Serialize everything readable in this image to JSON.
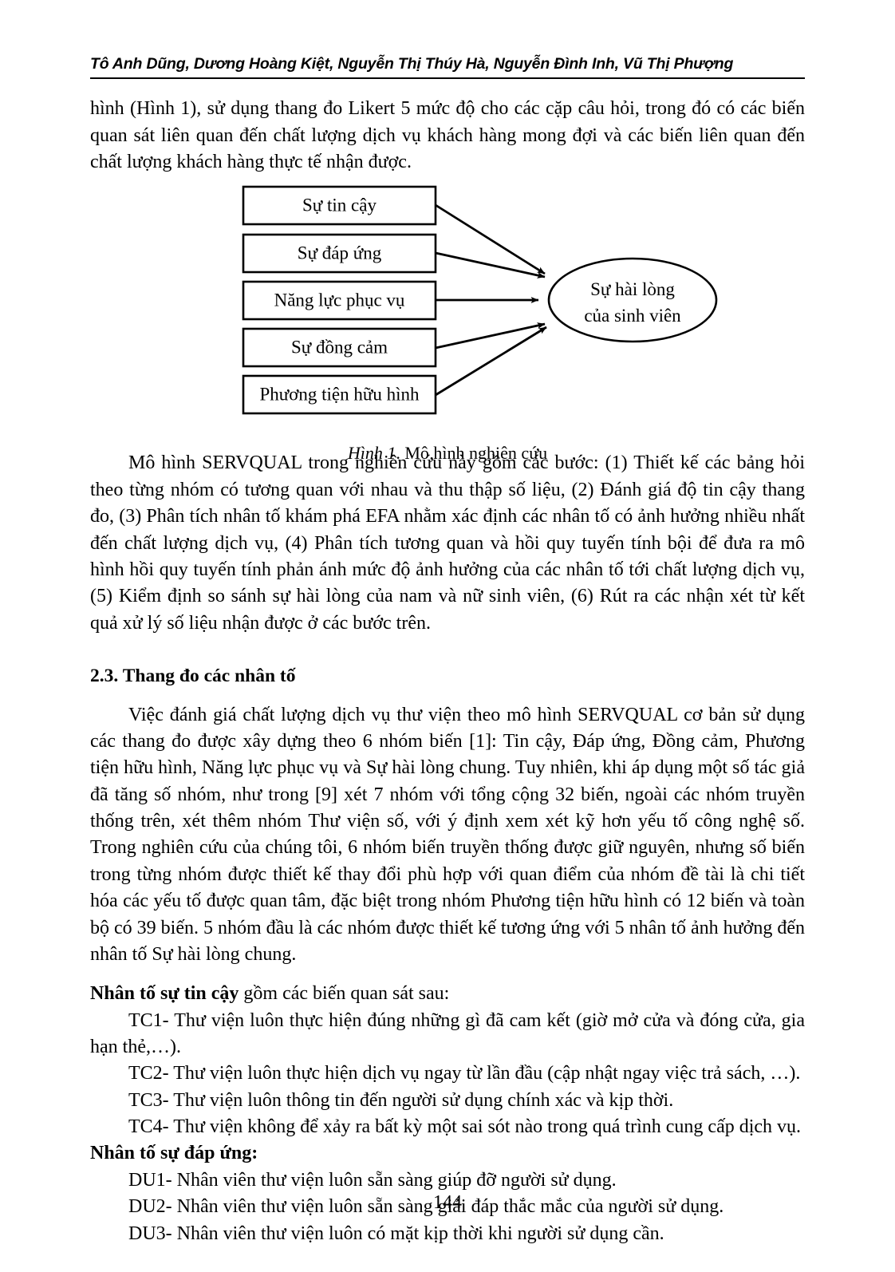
{
  "header": {
    "running_head": "Tô Anh Dũng, Dương Hoàng Kiệt, Nguyễn Thị Thúy Hà, Nguyễn Đình Inh, Vũ Thị Phượng"
  },
  "paragraphs": {
    "intro": "hình (Hình 1), sử dụng thang đo Likert 5 mức độ cho các cặp câu hỏi, trong đó có các biến quan sát liên quan đến chất lượng dịch vụ khách hàng mong đợi và các biến liên quan đến chất lượng khách hàng thực tế nhận được.",
    "servqual_steps": "Mô hình SERVQUAL trong nghiên cứu này gồm các bước: (1) Thiết kế các bảng hỏi theo từng nhóm có tương quan với nhau và thu thập số liệu, (2) Đánh giá độ tin cậy thang đo, (3) Phân tích nhân tố khám phá EFA nhằm xác định các nhân tố có ảnh hưởng nhiều nhất đến chất lượng dịch vụ, (4) Phân tích tương quan và hồi quy tuyến tính bội để đưa ra mô hình hồi quy tuyến tính phản ánh mức độ ảnh hưởng của các nhân tố tới chất lượng dịch vụ, (5) Kiểm định so sánh sự hài lòng của nam và nữ sinh viên, (6) Rút ra các nhận xét từ kết quả xử lý số liệu nhận được ở các bước trên.",
    "scales": "Việc đánh giá chất lượng dịch vụ thư viện theo mô hình SERVQUAL cơ bản sử dụng các thang đo được xây dựng theo 6 nhóm biến [1]: Tin cậy, Đáp ứng, Đồng cảm, Phương tiện hữu hình, Năng lực phục vụ và Sự hài lòng chung. Tuy nhiên, khi áp dụng một số tác giả đã tăng số nhóm, như trong [9] xét 7 nhóm với tổng cộng 32 biến, ngoài các nhóm truyền thống trên, xét thêm nhóm Thư viện số, với ý định xem xét kỹ hơn yếu tố công nghệ số. Trong nghiên cứu của chúng tôi, 6 nhóm biến truyền thống được giữ nguyên, nhưng số biến trong từng nhóm được thiết kế thay đổi phù hợp với quan điểm của nhóm đề tài là chi tiết hóa các yếu tố được quan tâm, đặc biệt trong nhóm Phương tiện hữu hình có 12 biến và toàn bộ có 39 biến. 5 nhóm đầu là các nhóm được thiết kế tương ứng với 5 nhân tố ảnh hưởng đến nhân tố Sự hài lòng chung."
  },
  "sections": {
    "scale_heading": "2.3. Thang đo các nhân tố"
  },
  "factors": [
    {
      "lead": "Nhân tố sự tin cậy",
      "lead_tail": " gồm các biến quan sát sau:",
      "items": [
        "TC1- Thư viện luôn thực hiện đúng những gì đã cam kết (giờ mở cửa và đóng cửa, gia hạn thẻ,…).",
        "TC2- Thư viện luôn thực hiện dịch vụ ngay từ lần đầu (cập nhật ngay việc trả sách, …).",
        "TC3- Thư viện luôn thông tin đến người sử dụng chính xác và kịp thời.",
        "TC4- Thư viện không để xảy ra bất kỳ một sai sót nào trong quá trình cung cấp dịch vụ."
      ]
    },
    {
      "lead": "Nhân tố sự đáp ứng:",
      "lead_tail": "",
      "items": [
        "DU1- Nhân viên thư viện luôn sẵn sàng giúp đỡ người sử dụng.",
        "DU2- Nhân viên thư viện luôn sẵn sàng giải đáp thắc mắc của người sử dụng.",
        "DU3- Nhân viên thư viện luôn có mặt kịp thời khi người sử dụng cần."
      ]
    }
  ],
  "figure": {
    "caption_number": "Hình 1",
    "caption_text": ". Mô hình nghiên cứu",
    "boxes": [
      "Sự tin cậy",
      "Sự đáp ứng",
      "Năng lực phục vụ",
      "Sự đồng cảm",
      "Phương tiện hữu hình"
    ],
    "outcome_line1": "Sự hài lòng",
    "outcome_line2": "của sinh viên",
    "stroke_color": "#000000"
  },
  "footer": {
    "page_number": "144"
  }
}
